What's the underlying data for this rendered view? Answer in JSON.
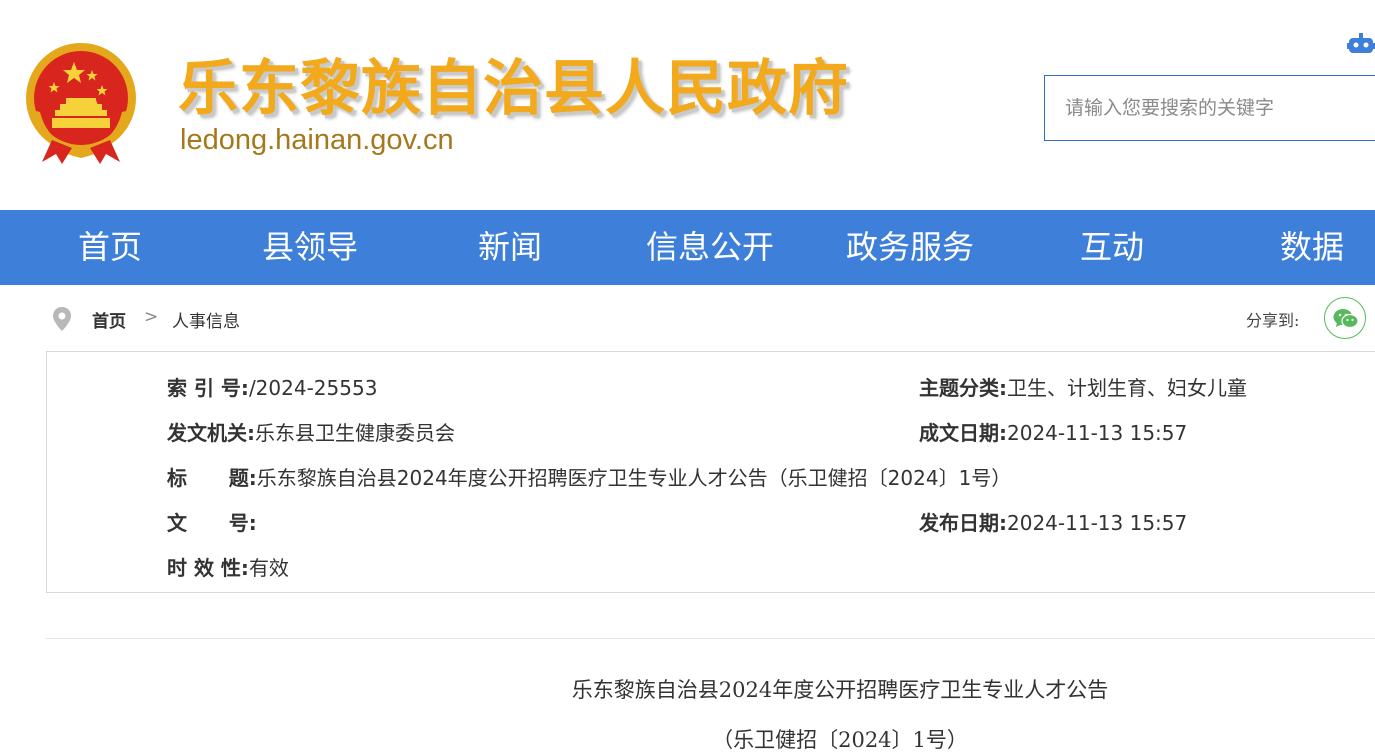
{
  "header": {
    "site_title": "乐东黎族自治县人民政府",
    "site_url": "ledong.hainan.gov.cn",
    "search_placeholder": "请输入您要搜索的关键字"
  },
  "nav": {
    "items": [
      "首页",
      "县领导",
      "新闻",
      "信息公开",
      "政务服务",
      "互动",
      "数据"
    ]
  },
  "breadcrumb": {
    "home": "首页",
    "separator": ">",
    "current": "人事信息",
    "share_label": "分享到:"
  },
  "meta": {
    "index_label": "索 引 号:",
    "index_value": "/2024-25553",
    "topic_label": "主题分类:",
    "topic_value": "卫生、计划生育、妇女儿童",
    "issuer_label": "发文机关:",
    "issuer_value": "乐东县卫生健康委员会",
    "written_label": "成文日期:",
    "written_value": "2024-11-13 15:57",
    "title_label": "标      题:",
    "title_value": "乐东黎族自治县2024年度公开招聘医疗卫生专业人才公告（乐卫健招〔2024〕1号）",
    "docno_label": "文      号:",
    "docno_value": "",
    "published_label": "发布日期:",
    "published_value": "2024-11-13 15:57",
    "validity_label": "时 效 性:",
    "validity_value": "有效"
  },
  "article": {
    "title": "乐东黎族自治县2024年度公开招聘医疗卫生专业人才公告",
    "subtitle": "（乐卫健招〔2024〕1号）"
  },
  "colors": {
    "nav_bg": "#3d7fd9",
    "title_gold": "#f2a91c",
    "url_gold": "#a5791b",
    "wechat_green": "#57b95b"
  }
}
